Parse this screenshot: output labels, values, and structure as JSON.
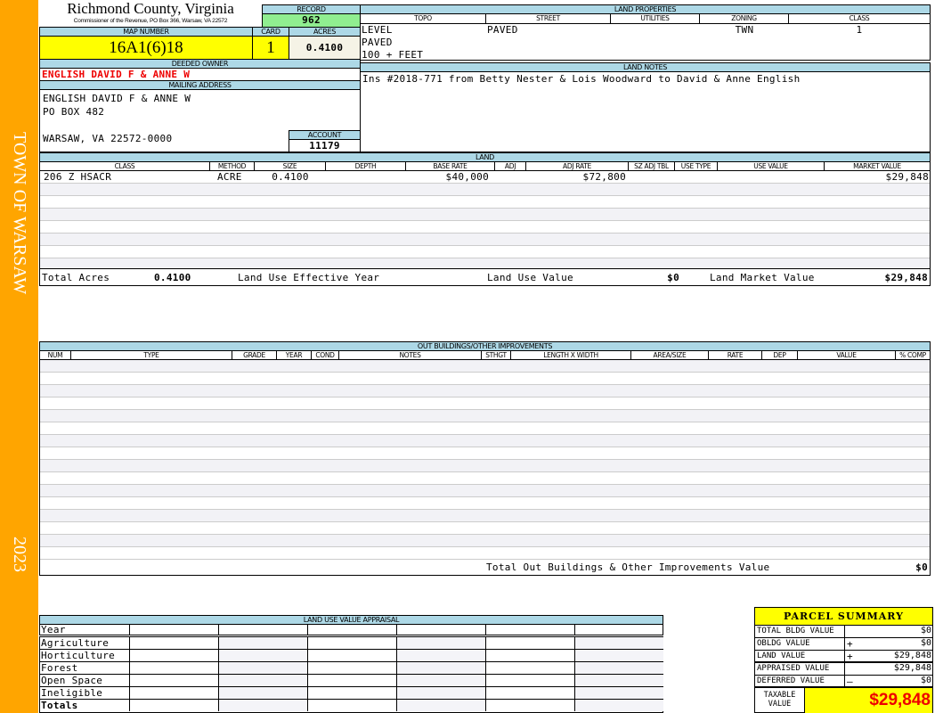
{
  "sidebar": {
    "town": "TOWN OF WARSAW",
    "year": "2023",
    "color": "#FFA500"
  },
  "header": {
    "county": "Richmond County, Virginia",
    "subtitle": "Commissioner of the Revenue, PO Box 366, Warsaw, VA 22572",
    "record_label": "RECORD",
    "record": "962"
  },
  "parcel": {
    "map_label": "MAP NUMBER",
    "map_number": "16A1(6)18",
    "card_label": "CARD",
    "card": "1",
    "acres_label": "ACRES",
    "acres": "0.4100"
  },
  "owner": {
    "deeded_label": "DEEDED OWNER",
    "deeded_owner": "ENGLISH DAVID F & ANNE W",
    "mailing_label": "MAILING ADDRESS",
    "address": [
      "ENGLISH DAVID F & ANNE W",
      "PO BOX 482",
      "",
      "WARSAW, VA 22572-0000"
    ],
    "account_label": "ACCOUNT",
    "account": "11179"
  },
  "land_properties": {
    "label": "LAND PROPERTIES",
    "headers": [
      "TOPO",
      "STREET",
      "UTILITIES",
      "ZONING",
      "CLASS"
    ],
    "topo": [
      "LEVEL",
      "PAVED",
      "100 + FEET"
    ],
    "street": "PAVED",
    "utilities": "",
    "zoning": "TWN",
    "class": "1"
  },
  "land_notes": {
    "label": "LAND NOTES",
    "text": "Ins #2018-771 from Betty Nester & Lois Woodward to David & Anne English"
  },
  "land": {
    "label": "LAND",
    "headers": [
      "CLASS",
      "METHOD",
      "SIZE",
      "DEPTH",
      "BASE RATE",
      "ADJ",
      "ADJ RATE",
      "SZ ADJ TBL",
      "USE TYPE",
      "USE VALUE",
      "MARKET VALUE"
    ],
    "rows": [
      {
        "class": "206 Z HSACR",
        "method": "ACRE",
        "size": "0.4100",
        "depth": "",
        "base_rate": "$40,000",
        "adj": "",
        "adj_rate": "$72,800",
        "sz_adj_tbl": "",
        "use_type": "",
        "use_value": "",
        "market_value": "$29,848"
      }
    ],
    "total_acres_label": "Total Acres",
    "total_acres": "0.4100",
    "effective_year_label": "Land Use Effective Year",
    "effective_year": "",
    "use_value_label": "Land Use Value",
    "use_value": "$0",
    "market_value_label": "Land Market Value",
    "market_value": "$29,848"
  },
  "outbuildings": {
    "label": "OUT BUILDINGS/OTHER IMPROVEMENTS",
    "headers": [
      "NUM",
      "TYPE",
      "GRADE",
      "YEAR",
      "COND",
      "NOTES",
      "STHGT",
      "LENGTH X WIDTH",
      "AREA/SIZE",
      "RATE",
      "DEP",
      "VALUE",
      "% COMP"
    ],
    "total_label": "Total Out Buildings & Other Improvements Value",
    "total": "$0"
  },
  "land_use": {
    "label": "LAND USE VALUE APPRAISAL",
    "year_label": "Year",
    "rows": [
      "Agriculture",
      "Horticulture",
      "Forest",
      "Open Space",
      "Ineligible",
      "Totals"
    ]
  },
  "summary": {
    "title": "PARCEL SUMMARY",
    "rows": [
      {
        "label": "TOTAL BLDG VALUE",
        "op": "",
        "value": "$0"
      },
      {
        "label": "OBLDG VALUE",
        "op": "+",
        "value": "$0"
      },
      {
        "label": "LAND VALUE",
        "op": "+",
        "value": "$29,848"
      },
      {
        "label": "APPRAISED VALUE",
        "op": "",
        "value": "$29,848"
      },
      {
        "label": "DEFERRED VALUE",
        "op": "–",
        "value": "$0"
      }
    ],
    "taxable_label": "TAXABLE VALUE",
    "taxable": "$29,848"
  }
}
